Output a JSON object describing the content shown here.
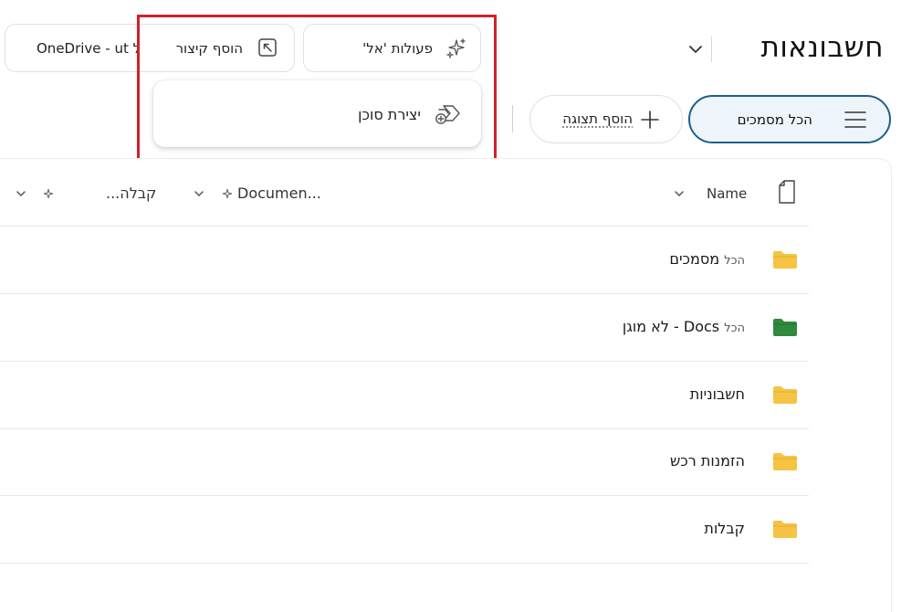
{
  "header": {
    "title": "חשבונאות",
    "ai_actions_label": "פעולות 'אל'",
    "add_shortcut_label": "הוסף קיצור",
    "onedrive_label": "OneDrive - ut ל"
  },
  "popup": {
    "create_agent_label": "יצירת סוכן"
  },
  "views": {
    "active_view_label": "הכל מסמכים",
    "add_view_label": "הוסף תצוגה"
  },
  "table": {
    "columns": {
      "name": "Name",
      "documents": "Documen...",
      "receipts": "קבלה..."
    },
    "rows": [
      {
        "prefix": "הכל",
        "label": "מסמכים",
        "folder_color": "#f6c445"
      },
      {
        "prefix": "הכל",
        "label": "Docs - לא מוגן",
        "folder_color": "#2f8a3e"
      },
      {
        "prefix": "",
        "label": "חשבוניות",
        "folder_color": "#f6c445"
      },
      {
        "prefix": "",
        "label": "הזמנות רכש",
        "folder_color": "#f6c445"
      },
      {
        "prefix": "",
        "label": "קבלות",
        "folder_color": "#f6c445"
      }
    ]
  },
  "colors": {
    "highlight": "#d3202d",
    "active_view_border": "#1f5f8b",
    "folder_yellow": "#f6c445",
    "folder_green": "#2f8a3e"
  }
}
